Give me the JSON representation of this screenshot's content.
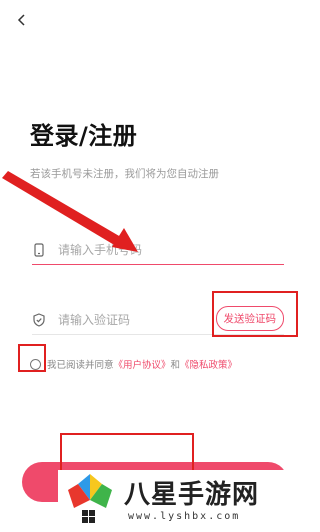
{
  "header": {
    "back_icon": "chevron-left-icon"
  },
  "title": "登录/注册",
  "subtitle": "若该手机号未注册，我们将为您自动注册",
  "phone": {
    "icon": "phone-icon",
    "placeholder": "请输入手机号码"
  },
  "code": {
    "icon": "shield-icon",
    "placeholder": "请输入验证码",
    "send_label": "发送验证码"
  },
  "agreement": {
    "prefix": "我已阅读并同意",
    "user_agreement": "《用户协议》",
    "and": "和",
    "privacy_policy": "《隐私政策》"
  },
  "colors": {
    "accent": "#ef4a6b",
    "annotation": "#e02020"
  },
  "watermark": {
    "title": "八星手游网",
    "url": "www.lyshbx.com"
  }
}
